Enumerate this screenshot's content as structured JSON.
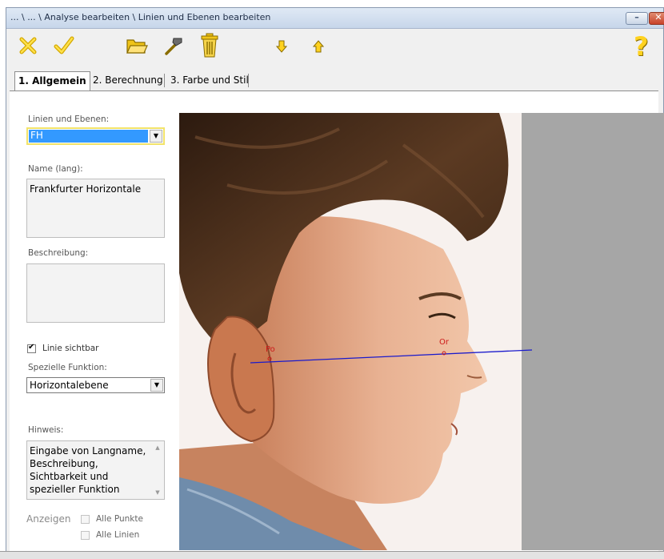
{
  "window": {
    "title": "... \\ ... \\ Analyse bearbeiten \\ Linien und Ebenen bearbeiten",
    "minimize_glyph": "–",
    "close_glyph": "✕"
  },
  "toolbar": {
    "icons": [
      "cancel-icon",
      "ok-icon",
      "open-folder-icon",
      "hammer-icon",
      "trash-icon",
      "move-down-icon",
      "move-up-icon",
      "help-icon"
    ]
  },
  "tabs": [
    {
      "label": "1. Allgemein",
      "active": true
    },
    {
      "label": "2. Berechnung",
      "active": false
    },
    {
      "label": "3. Farbe und Stil",
      "active": false
    }
  ],
  "form": {
    "lines_label": "Linien und Ebenen:",
    "lines_value": "FH",
    "name_label": "Name (lang):",
    "name_value": "Frankfurter Horizontale",
    "description_label": "Beschreibung:",
    "description_value": "",
    "visible_label": "Linie sichtbar",
    "visible_checked": true,
    "function_label": "Spezielle Funktion:",
    "function_value": "Horizontalebene",
    "hint_label": "Hinweis:",
    "hint_lines": [
      "Eingabe von Langname,",
      "Beschreibung,",
      "Sichtbarkeit und",
      "spezieller Funktion"
    ],
    "show_label": "Anzeigen",
    "show_all_points": "Alle Punkte",
    "show_all_lines": "Alle Linien"
  },
  "image": {
    "point_po_label": "Po",
    "point_or_label": "Or",
    "line_color": "#1a1acc",
    "point_color": "#cc1a1a"
  }
}
